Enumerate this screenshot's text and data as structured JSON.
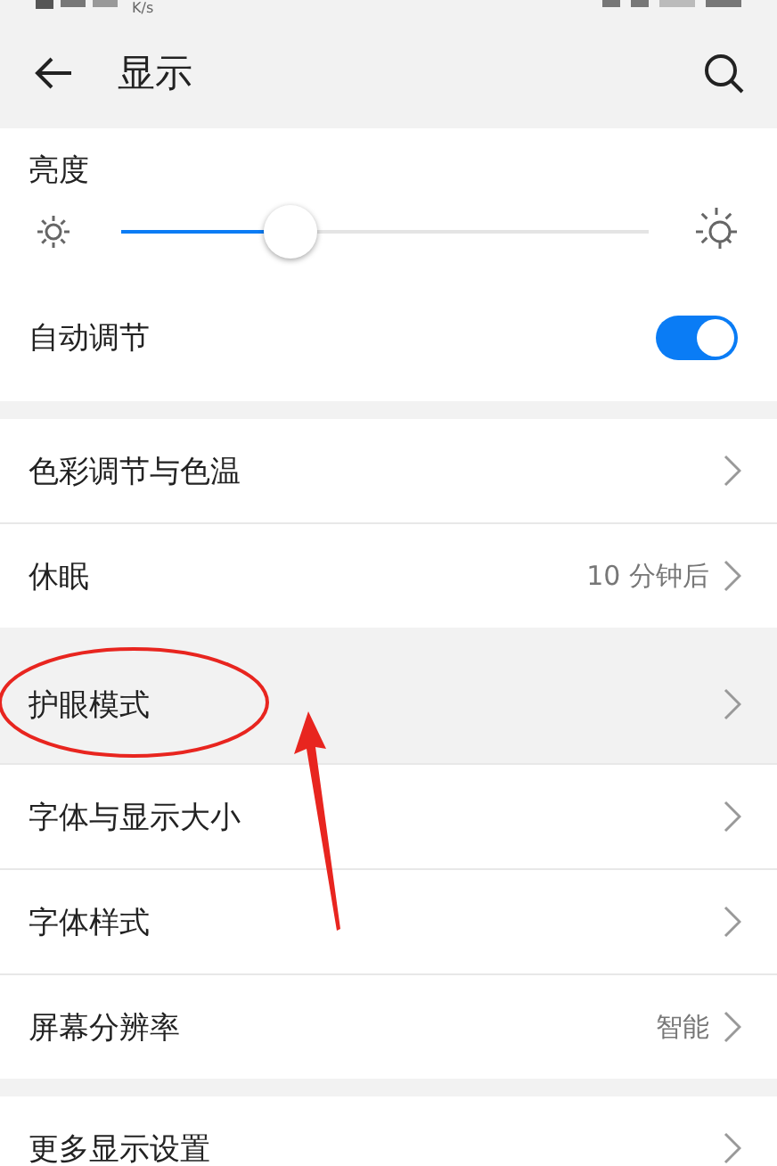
{
  "status_bar": {
    "speed_unit": "K/s"
  },
  "header": {
    "title": "显示"
  },
  "brightness": {
    "label": "亮度",
    "level": 0.32
  },
  "auto_adjust": {
    "label": "自动调节",
    "on": true
  },
  "groups": [
    {
      "items": [
        {
          "label": "色彩调节与色温",
          "highlighted": false
        },
        {
          "label": "休眠",
          "value": "10 分钟后",
          "highlighted": false
        }
      ]
    },
    {
      "items": [
        {
          "label": "护眼模式",
          "highlighted": true
        },
        {
          "label": "字体与显示大小",
          "highlighted": false
        },
        {
          "label": "字体样式",
          "highlighted": false
        },
        {
          "label": "屏幕分辨率",
          "value": "智能",
          "highlighted": false
        }
      ]
    },
    {
      "items": [
        {
          "label": "更多显示设置",
          "highlighted": false
        }
      ]
    }
  ],
  "annotations": {
    "ellipse": true,
    "arrow": true
  }
}
